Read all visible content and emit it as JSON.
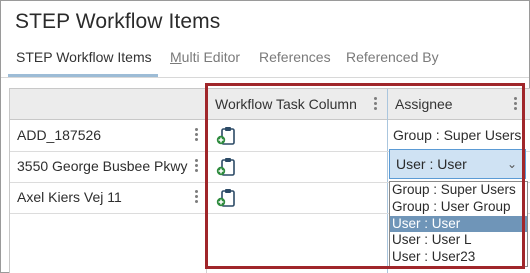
{
  "window": {
    "title": "STEP Workflow Items"
  },
  "tabs": [
    {
      "label": "STEP Workflow Items",
      "active": true
    },
    {
      "label_prefix": "M",
      "label_rest": "ulti Editor",
      "active": false
    },
    {
      "label": "References",
      "active": false
    },
    {
      "label": "Referenced By",
      "active": false
    }
  ],
  "grid": {
    "columns": [
      {
        "label": ""
      },
      {
        "label": "Workflow Task Column"
      },
      {
        "label": "Assignee"
      }
    ],
    "rows": [
      {
        "name": "ADD_187526",
        "task_icon": "clipboard-add-icon",
        "assignee": "Group : Super Users"
      },
      {
        "name": "3550 George Busbee Pkwy",
        "task_icon": "clipboard-add-icon",
        "assignee": "User : User"
      },
      {
        "name": "Axel Kiers Vej 11",
        "task_icon": "clipboard-add-icon",
        "assignee": ""
      }
    ]
  },
  "assignee_dropdown": {
    "current_value": "User : User",
    "options": [
      {
        "label": "Group : Super Users",
        "selected": false
      },
      {
        "label": "Group : User Group",
        "selected": false
      },
      {
        "label": "User : User",
        "selected": true
      },
      {
        "label": "User : User L",
        "selected": false
      },
      {
        "label": "User : User23",
        "selected": false
      }
    ]
  },
  "colors": {
    "highlight_border": "#a0262a",
    "select_bg": "#cfe2f3",
    "selected_option_bg": "#6f95b8",
    "tab_underline": "#9dbcd6"
  }
}
